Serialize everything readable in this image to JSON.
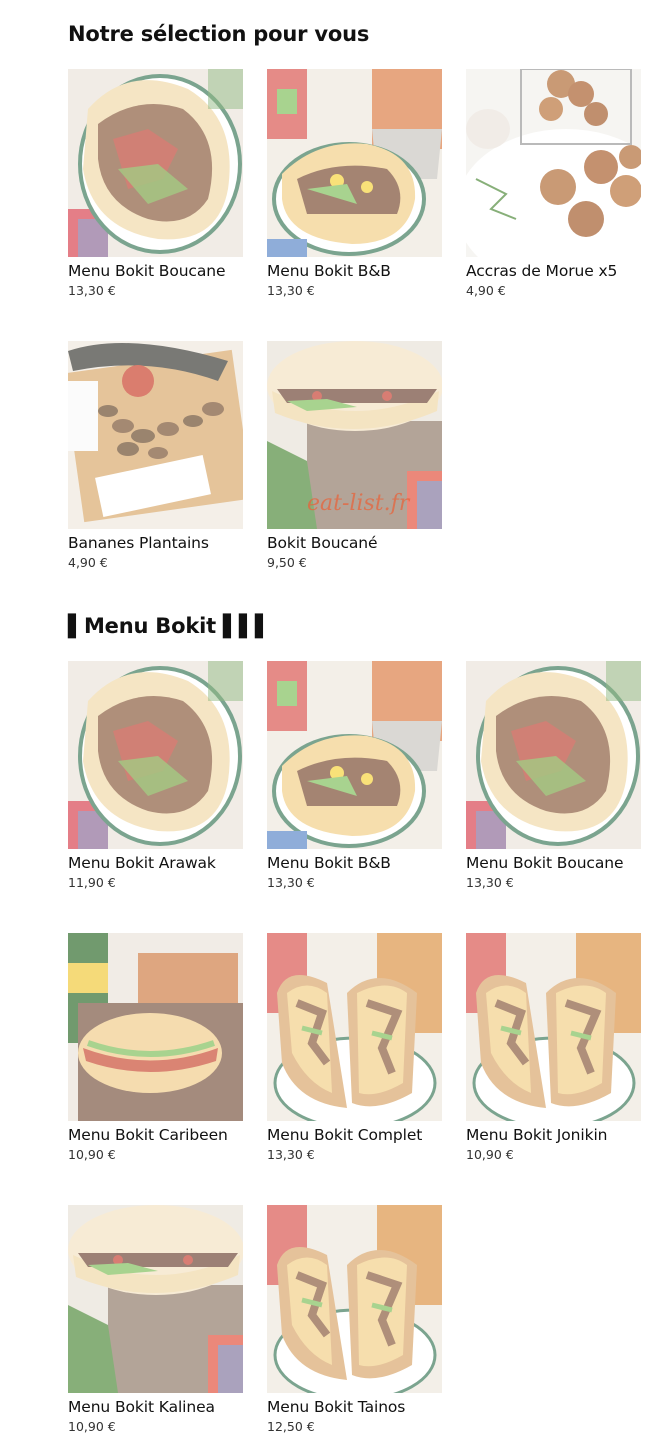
{
  "sections": [
    {
      "title": "Notre sélection pour vous",
      "items": [
        {
          "name": "Menu Bokit Boucane",
          "price": "13,30 €",
          "photo": "bokit-open"
        },
        {
          "name": "Menu Bokit B&B",
          "price": "13,30 €",
          "photo": "bokit-fries"
        },
        {
          "name": "Accras de Morue x5",
          "price": "4,90 €",
          "photo": "accras"
        },
        {
          "name": "Bananes Plantains",
          "price": "4,90 €",
          "photo": "plantains"
        },
        {
          "name": "Bokit Boucané",
          "price": "9,50 €",
          "photo": "bokit-crate",
          "watermark": "eat-list.fr"
        }
      ]
    },
    {
      "title": "▌Menu Bokit ▌▌▌",
      "items": [
        {
          "name": "Menu Bokit Arawak",
          "price": "11,90 €",
          "photo": "bokit-open"
        },
        {
          "name": "Menu Bokit B&B",
          "price": "13,30 €",
          "photo": "bokit-fries"
        },
        {
          "name": "Menu Bokit Boucane",
          "price": "13,30 €",
          "photo": "bokit-open"
        },
        {
          "name": "Menu Bokit Caribeen",
          "price": "10,90 €",
          "photo": "bokit-can"
        },
        {
          "name": "Menu Bokit Complet",
          "price": "13,30 €",
          "photo": "bokit-wrap"
        },
        {
          "name": "Menu Bokit Jonikin",
          "price": "10,90 €",
          "photo": "bokit-wrap"
        },
        {
          "name": "Menu Bokit Kalinea",
          "price": "10,90 €",
          "photo": "bokit-crate"
        },
        {
          "name": "Menu Bokit Tainos",
          "price": "12,50 €",
          "photo": "bokit-wrap"
        }
      ]
    }
  ]
}
